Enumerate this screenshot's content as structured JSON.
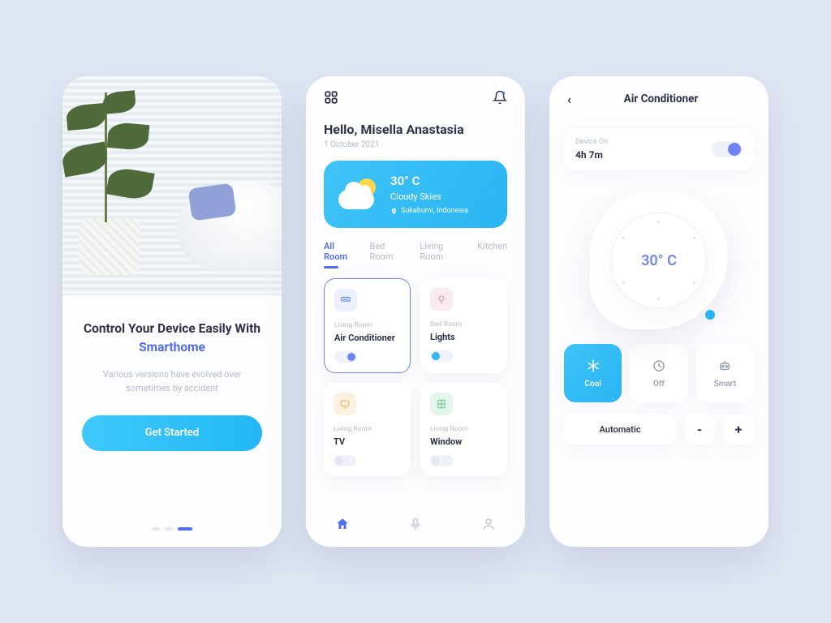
{
  "onboard": {
    "title_pre": "Control Your Device Easily With ",
    "title_brand": "Smarthome",
    "subtitle": "Various versions have evolved over sometimes by accident",
    "cta": "Get Started",
    "page_index": 2,
    "page_count": 3
  },
  "home": {
    "greeting": "Hello, Misella Anastasia",
    "date": "1 October 2021",
    "weather": {
      "temp": "30° C",
      "condition": "Cloudy Skies",
      "location": "Sukabumi, Indonesia"
    },
    "tabs": [
      "All Room",
      "Bed Room",
      "Living Room",
      "Kitchen"
    ],
    "active_tab": 0,
    "devices": [
      {
        "room": "Living Room",
        "name": "Air Conditioner",
        "icon": "ac",
        "accent": "blue",
        "on": true,
        "selected": true
      },
      {
        "room": "Bed Room",
        "name": "Lights",
        "icon": "bulb",
        "accent": "pink",
        "on": true,
        "selected": false
      },
      {
        "room": "Living Room",
        "name": "TV",
        "icon": "tv",
        "accent": "orange",
        "on": false,
        "selected": false
      },
      {
        "room": "Living Room",
        "name": "Window",
        "icon": "window",
        "accent": "green",
        "on": false,
        "selected": false
      }
    ]
  },
  "detail": {
    "title": "Air Conditioner",
    "status_label": "Device On",
    "uptime": "4h 7m",
    "power": true,
    "dial_temp": "30° C",
    "modes": [
      {
        "label": "Cool",
        "icon": "snow",
        "active": true
      },
      {
        "label": "Off",
        "icon": "clock",
        "active": false
      },
      {
        "label": "Smart",
        "icon": "chip",
        "active": false
      }
    ],
    "fan_mode": "Automatic",
    "minus": "-",
    "plus": "+"
  }
}
